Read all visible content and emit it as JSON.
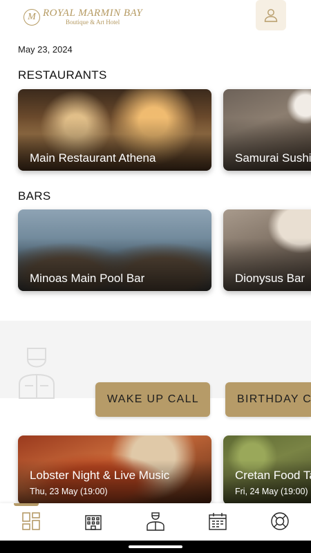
{
  "header": {
    "logo_mark": "M",
    "logo_name": "ROYAL MARMIN BAY",
    "logo_sub": "Boutique & Art Hotel",
    "profile_icon": "user-icon"
  },
  "date": "May 23, 2024",
  "restaurants": {
    "title": "RESTAURANTS",
    "items": [
      {
        "label": "Main Restaurant Athena"
      },
      {
        "label": "Samurai Sushi"
      }
    ]
  },
  "bars": {
    "title": "BARS",
    "items": [
      {
        "label": "Minoas Main Pool Bar"
      },
      {
        "label": "Dionysus Bar"
      }
    ]
  },
  "services": {
    "icon": "concierge-icon",
    "buttons": [
      {
        "label": "WAKE UP CALL"
      },
      {
        "label": "BIRTHDAY C"
      }
    ]
  },
  "events": {
    "items": [
      {
        "title": "Lobster Night & Live Music",
        "date": "Thu, 23 May (19:00)"
      },
      {
        "title": "Cretan Food Ta",
        "date": "Fri, 24 May (19:00)"
      }
    ]
  },
  "nav": {
    "items": [
      {
        "icon": "dashboard-icon",
        "active": true
      },
      {
        "icon": "hotel-building-icon",
        "active": false
      },
      {
        "icon": "concierge-staff-icon",
        "active": false
      },
      {
        "icon": "calendar-icon",
        "active": false
      },
      {
        "icon": "lifebuoy-icon",
        "active": false
      }
    ]
  },
  "colors": {
    "accent": "#b69b68",
    "accent_light": "#f6efe3",
    "text": "#1a1a1a"
  }
}
